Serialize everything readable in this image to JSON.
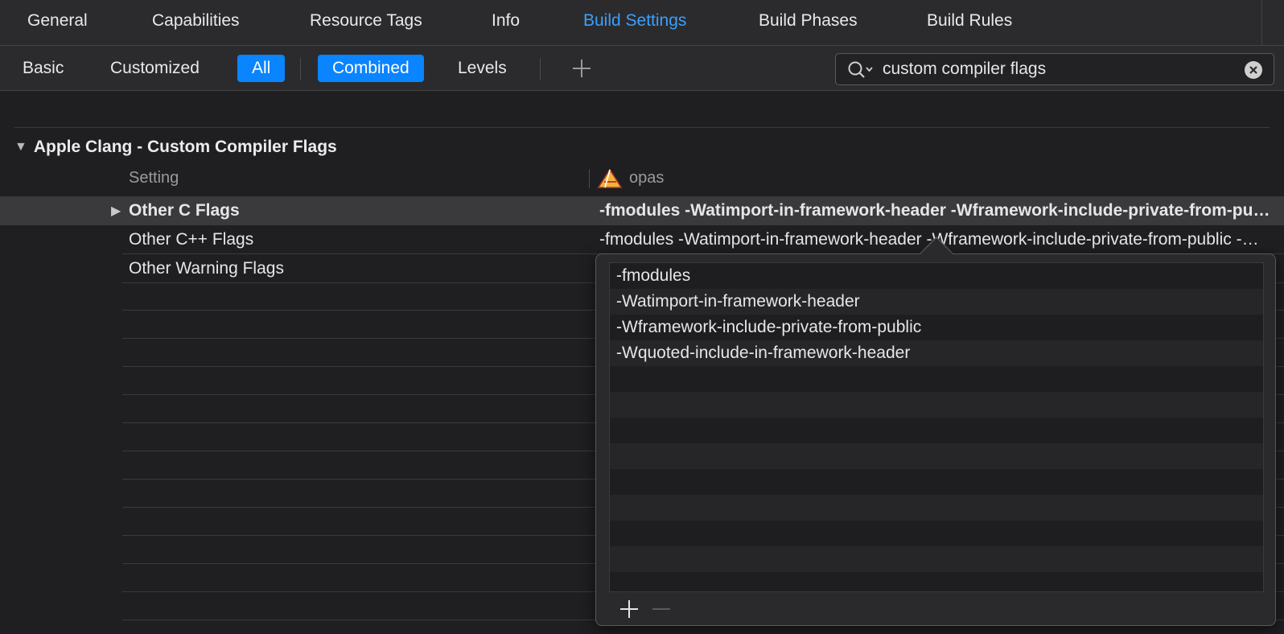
{
  "tabs": [
    {
      "label": "General",
      "active": false
    },
    {
      "label": "Capabilities",
      "active": false
    },
    {
      "label": "Resource Tags",
      "active": false
    },
    {
      "label": "Info",
      "active": false
    },
    {
      "label": "Build Settings",
      "active": true
    },
    {
      "label": "Build Phases",
      "active": false
    },
    {
      "label": "Build Rules",
      "active": false
    }
  ],
  "filters": {
    "basic": "Basic",
    "customized": "Customized",
    "all": "All",
    "combined": "Combined",
    "levels": "Levels"
  },
  "search": {
    "value": "custom compiler flags",
    "icon": "search-icon"
  },
  "section": {
    "title": "Apple Clang - Custom Compiler Flags",
    "column_setting": "Setting",
    "column_target": "opas"
  },
  "rows": [
    {
      "name": "Other C Flags",
      "value": "-fmodules -Watimport-in-framework-header -Wframework-include-private-from-public -Wquoted-include-in-framework-header"
    },
    {
      "name": "Other C++ Flags",
      "value": "-fmodules -Watimport-in-framework-header -Wframework-include-private-from-public -Wquoted-include-in-framework-header"
    },
    {
      "name": "Other Warning Flags",
      "value": ""
    }
  ],
  "popover": {
    "items": [
      "-fmodules",
      "-Watimport-in-framework-header",
      "-Wframework-include-private-from-public",
      "-Wquoted-include-in-framework-header"
    ]
  },
  "colors": {
    "accent": "#0a84ff",
    "active_tab": "#3aa0ff",
    "background": "#1f1f21"
  }
}
